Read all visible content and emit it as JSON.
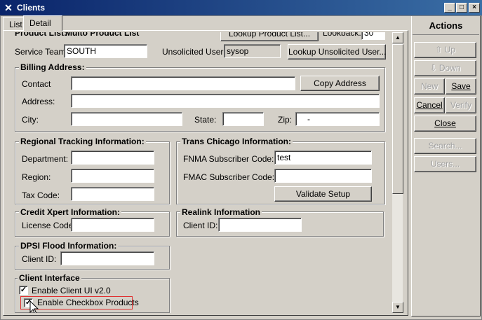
{
  "window": {
    "title": "Clients",
    "min": "_",
    "max": "□",
    "close": "×"
  },
  "tabs": [
    {
      "label": "List"
    },
    {
      "label": "Detail"
    }
  ],
  "top_partial": {
    "product_list_label": "Product List:",
    "product_list_value": "Multo Product List",
    "lookup_product_button": "Lookup Product List...",
    "lookback_label": "Lookback:",
    "lookback_value": "30"
  },
  "service_team": {
    "label": "Service Team:",
    "value": "SOUTH"
  },
  "unsolicited_user": {
    "label": "Unsolicited User:",
    "value": "sysop",
    "lookup_button": "Lookup Unsolicited User..."
  },
  "billing": {
    "title": "Billing Address:",
    "contact_label": "Contact",
    "contact_value": "",
    "copy_button": "Copy Address",
    "address_label": "Address:",
    "address_value": "",
    "city_label": "City:",
    "city_value": "",
    "state_label": "State:",
    "state_value": "",
    "zip_label": "Zip:",
    "zip_value": "-"
  },
  "regional": {
    "title": "Regional Tracking Information:",
    "department_label": "Department:",
    "department_value": "",
    "region_label": "Region:",
    "region_value": "",
    "taxcode_label": "Tax Code:",
    "taxcode_value": ""
  },
  "trans_chicago": {
    "title": "Trans Chicago Information:",
    "fnma_label": "FNMA Subscriber Code:",
    "fnma_value": "test",
    "fmac_label": "FMAC Subscriber Code:",
    "fmac_value": "",
    "validate_button": "Validate Setup"
  },
  "credit_xpert": {
    "title": "Credit Xpert Information:",
    "license_label": "License Code:",
    "license_value": ""
  },
  "realink": {
    "title": "Realink Information",
    "client_id_label": "Client ID:",
    "client_id_value": ""
  },
  "dpsi": {
    "title": "DPSI Flood Information:",
    "client_id_label": "Client ID:",
    "client_id_value": ""
  },
  "client_interface": {
    "title": "Client Interface",
    "enable_ui_label": "Enable Client UI v2.0",
    "enable_ui_checked": true,
    "enable_checkbox_label": "Enable Checkbox Products",
    "enable_checkbox_checked": true
  },
  "actions": {
    "title": "Actions",
    "up": "Up",
    "down": "Down",
    "new": "New",
    "save": "Save",
    "cancel": "Cancel",
    "verify": "Verify",
    "close": "Close",
    "search": "Search...",
    "users": "Users..."
  },
  "colors": {
    "titlebar": "#0a246a",
    "highlight_border": "#e03030"
  }
}
